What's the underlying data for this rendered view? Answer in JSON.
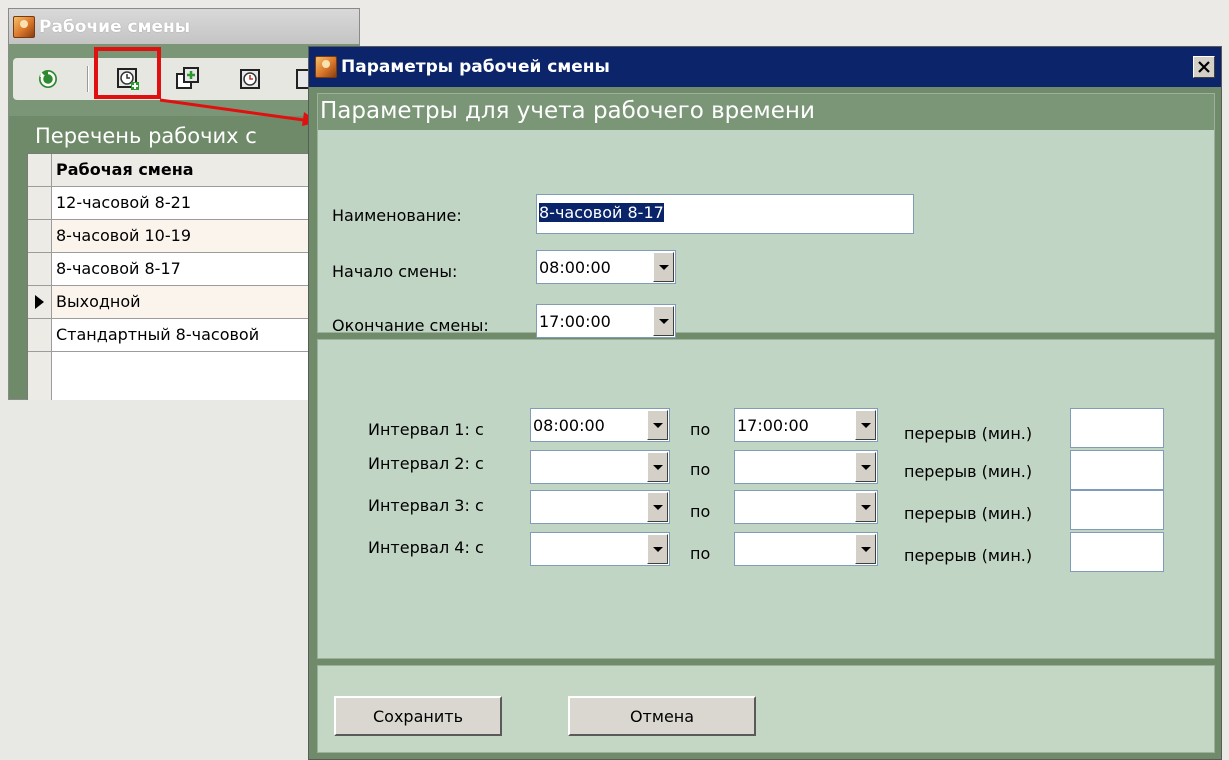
{
  "background_window": {
    "title": "Рабочие смены",
    "section_title": "Перечень рабочих с",
    "grid": {
      "header": "Рабочая смена",
      "rows": [
        {
          "label": "12-часовой 8-21"
        },
        {
          "label": "8-часовой 10-19"
        },
        {
          "label": "8-часовой 8-17"
        },
        {
          "label": "Выходной",
          "current": true
        },
        {
          "label": "Стандартный 8-часовой"
        }
      ]
    },
    "toolbar": [
      "refresh-icon",
      "add-shift-icon",
      "copy-shift-icon",
      "edit-shift-icon",
      "delete-shift-icon"
    ]
  },
  "dialog": {
    "title": "Параметры рабочей смены",
    "header": "Параметры для учета рабочего времени",
    "name_label": "Наименование:",
    "name_value": "8-часовой 8-17",
    "start_label": "Начало смены:",
    "start_value": "08:00:00",
    "end_label": "Окончание смены:",
    "end_value": "17:00:00",
    "intervals": [
      {
        "label": "Интервал 1:  с",
        "from": "08:00:00",
        "to_label": "по",
        "to": "17:00:00",
        "break_label": "перерыв (мин.)",
        "break": ""
      },
      {
        "label": "Интервал 2:  с",
        "from": "",
        "to_label": "по",
        "to": "",
        "break_label": "перерыв (мин.)",
        "break": ""
      },
      {
        "label": "Интервал 3:  с",
        "from": "",
        "to_label": "по",
        "to": "",
        "break_label": "перерыв (мин.)",
        "break": ""
      },
      {
        "label": "Интервал 4:  с",
        "from": "",
        "to_label": "по",
        "to": "",
        "break_label": "перерыв (мин.)",
        "break": ""
      }
    ],
    "save_label": "Сохранить",
    "cancel_label": "Отмена"
  },
  "colors": {
    "dialog_title_bg": "#0b246a",
    "panel_bg": "#c1d5c4",
    "header_green": "#7a9677",
    "highlight_red": "#e01010"
  }
}
